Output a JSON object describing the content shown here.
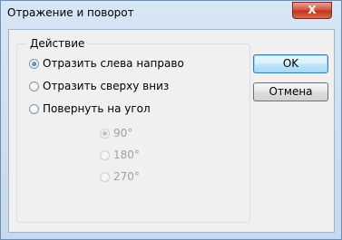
{
  "window": {
    "title": "Отражение и поворот",
    "close_glyph": "X"
  },
  "group": {
    "legend": "Действие",
    "options": [
      {
        "label": "Отразить слева направо",
        "checked": true
      },
      {
        "label": "Отразить сверху вниз",
        "checked": false
      },
      {
        "label": "Повернуть на угол",
        "checked": false
      }
    ],
    "angles": [
      {
        "label": "90°",
        "checked": true,
        "enabled": false
      },
      {
        "label": "180°",
        "checked": false,
        "enabled": false
      },
      {
        "label": "270°",
        "checked": false,
        "enabled": false
      }
    ]
  },
  "buttons": {
    "ok_label": "OK",
    "cancel_label": "Отмена"
  }
}
